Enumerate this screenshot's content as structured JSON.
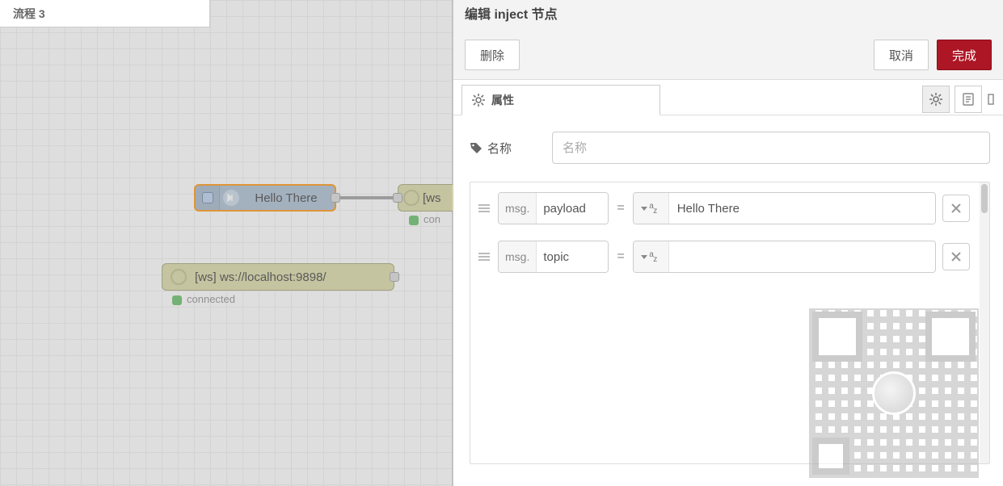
{
  "canvas": {
    "tab_label": "流程 3",
    "inject_node_label": "Hello There",
    "ws_out_label": "[ws",
    "ws_out_status": "con",
    "ws_in_label": "[ws] ws://localhost:9898/",
    "ws_in_status": "connected"
  },
  "panel": {
    "title": "编辑 inject 节点",
    "delete_label": "删除",
    "cancel_label": "取消",
    "done_label": "完成",
    "tab_props_label": "属性",
    "name_label": "名称",
    "name_placeholder": "名称",
    "name_value": "",
    "msg_prefix": "msg.",
    "type_glyph": "a_z",
    "props": [
      {
        "key": "payload",
        "value": "Hello There"
      },
      {
        "key": "topic",
        "value": ""
      }
    ]
  }
}
